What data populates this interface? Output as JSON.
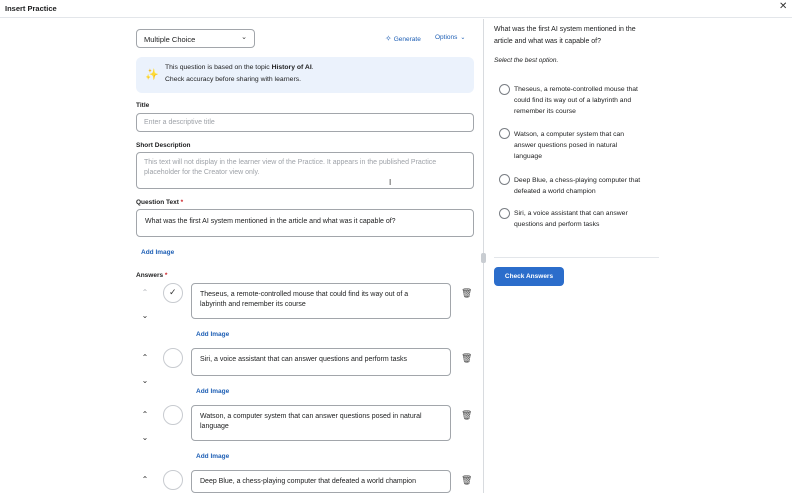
{
  "window": {
    "title": "Insert Practice",
    "close_icon": "close-icon"
  },
  "editor": {
    "question_type": "Multiple Choice",
    "generate_label": "Generate",
    "options_label": "Options",
    "banner": {
      "prefix": "This question is based on the topic ",
      "topic": "History of AI",
      "suffix": ".",
      "line2": "Check accuracy before sharing with learners."
    },
    "title_label": "Title",
    "title_placeholder": "Enter a descriptive title",
    "short_desc_label": "Short Description",
    "short_desc_placeholder_line1": "This text will not display in the learner view of the Practice. It appears in the published Practice",
    "short_desc_placeholder_line2": "placeholder for the Creator view only.",
    "question_label": "Question Text",
    "required_mark": "*",
    "question_value": "What was the first AI system mentioned in the article and what was it capable of?",
    "add_image_label": "Add Image",
    "answers_label": "Answers",
    "answers": [
      {
        "line1": "Theseus, a remote-controlled mouse that could find its way out of a",
        "line2": "labyrinth and remember its course",
        "correct": true
      },
      {
        "line1": "Siri, a voice assistant that can answer questions and perform tasks",
        "line2": "",
        "correct": false
      },
      {
        "line1": "Watson, a computer system that can answer questions posed in natural",
        "line2": "language",
        "correct": false
      },
      {
        "line1": "Deep Blue, a chess-playing computer that defeated a world champion",
        "line2": "",
        "correct": false
      }
    ]
  },
  "preview": {
    "question_line1": "What was the first AI system mentioned in the",
    "question_line2": "article and what was it capable of?",
    "hint": "Select the best option.",
    "options": [
      {
        "line1": "Theseus, a remote-controlled mouse that",
        "line2": "could find its way out of a labyrinth and",
        "line3": "remember its course"
      },
      {
        "line1": "Watson, a computer system that can",
        "line2": "answer questions posed in natural",
        "line3": "language"
      },
      {
        "line1": "Deep Blue, a chess-playing computer that",
        "line2": "defeated a world champion",
        "line3": ""
      },
      {
        "line1": "Siri, a voice assistant that can answer",
        "line2": "questions and perform tasks",
        "line3": ""
      }
    ],
    "check_button": "Check Answers"
  },
  "colors": {
    "accent": "#2b6dcb",
    "link": "#1e5fb5",
    "banner_bg": "#ebf2fc",
    "required": "#cd2026"
  }
}
